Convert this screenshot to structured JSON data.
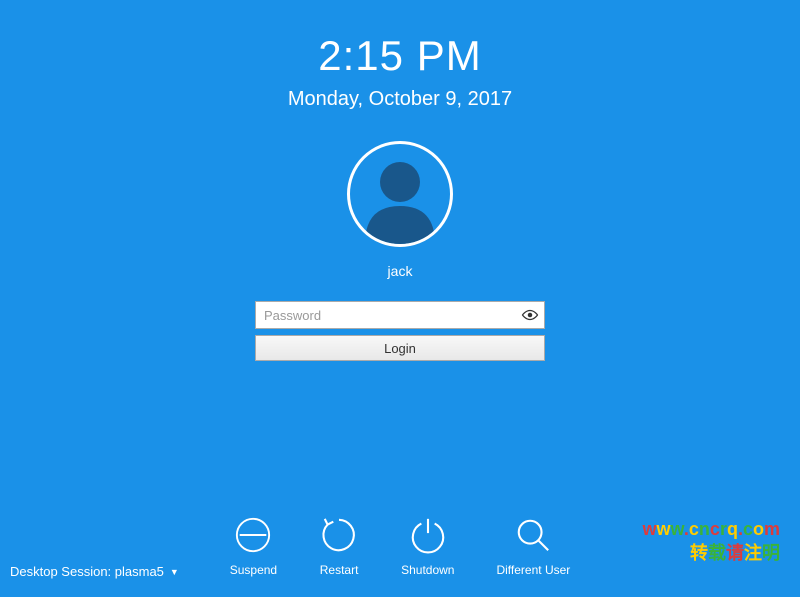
{
  "clock": {
    "time": "2:15 PM",
    "date": "Monday, October 9, 2017"
  },
  "user": {
    "name": "jack"
  },
  "login": {
    "password_placeholder": "Password",
    "button_label": "Login"
  },
  "actions": {
    "suspend": "Suspend",
    "restart": "Restart",
    "shutdown": "Shutdown",
    "different_user": "Different User"
  },
  "session": {
    "label": "Desktop Session: plasma5"
  },
  "watermark": {
    "line1": "www.cncrq.com",
    "line2": "转载请注明"
  }
}
